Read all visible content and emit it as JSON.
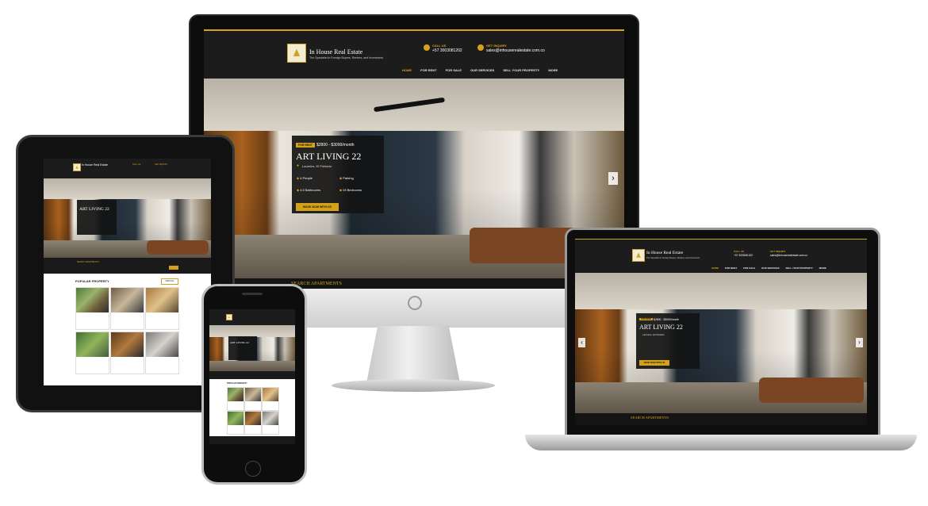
{
  "site": {
    "brand_name": "In House Real Estate",
    "brand_tagline": "The Specialist in Foreign Buyers, Renters, and Investment",
    "call_label": "CALL US",
    "call_value": "+57 3003081202",
    "inquiry_label": "GET INQUIRY",
    "inquiry_value": "sales@inhouserealestate.com.co"
  },
  "nav": {
    "items": [
      "HOME",
      "FOR RENT",
      "FOR SALE",
      "OUR SERVICES",
      "SELL YOUR PROPERTY",
      "MORE"
    ]
  },
  "hero": {
    "badge": "FOR RENT",
    "price": "$2800 - $3000/month",
    "title": "ART LIVING 22",
    "location": "Laureles, El Poblado",
    "features": [
      "4 People",
      "Parking",
      "4.5 Bathrooms",
      "03 Bedrooms"
    ],
    "cta": "BOOK NOW WITH US",
    "next_arrow": "›",
    "prev_arrow": "‹"
  },
  "search_bar": {
    "label": "SEARCH APARTMENTS"
  },
  "listings": {
    "heading": "POPULAR PROPERTY",
    "view_all": "VIEW ALL"
  },
  "colors": {
    "accent": "#d4a21a",
    "header_bg": "#1c1c1c",
    "body_bg": "#141414"
  },
  "icons": {
    "location": "location-icon",
    "phone": "phone-icon",
    "mail": "mail-icon",
    "people": "people-icon",
    "car": "car-icon",
    "bath": "bath-icon",
    "bed": "bed-icon"
  }
}
